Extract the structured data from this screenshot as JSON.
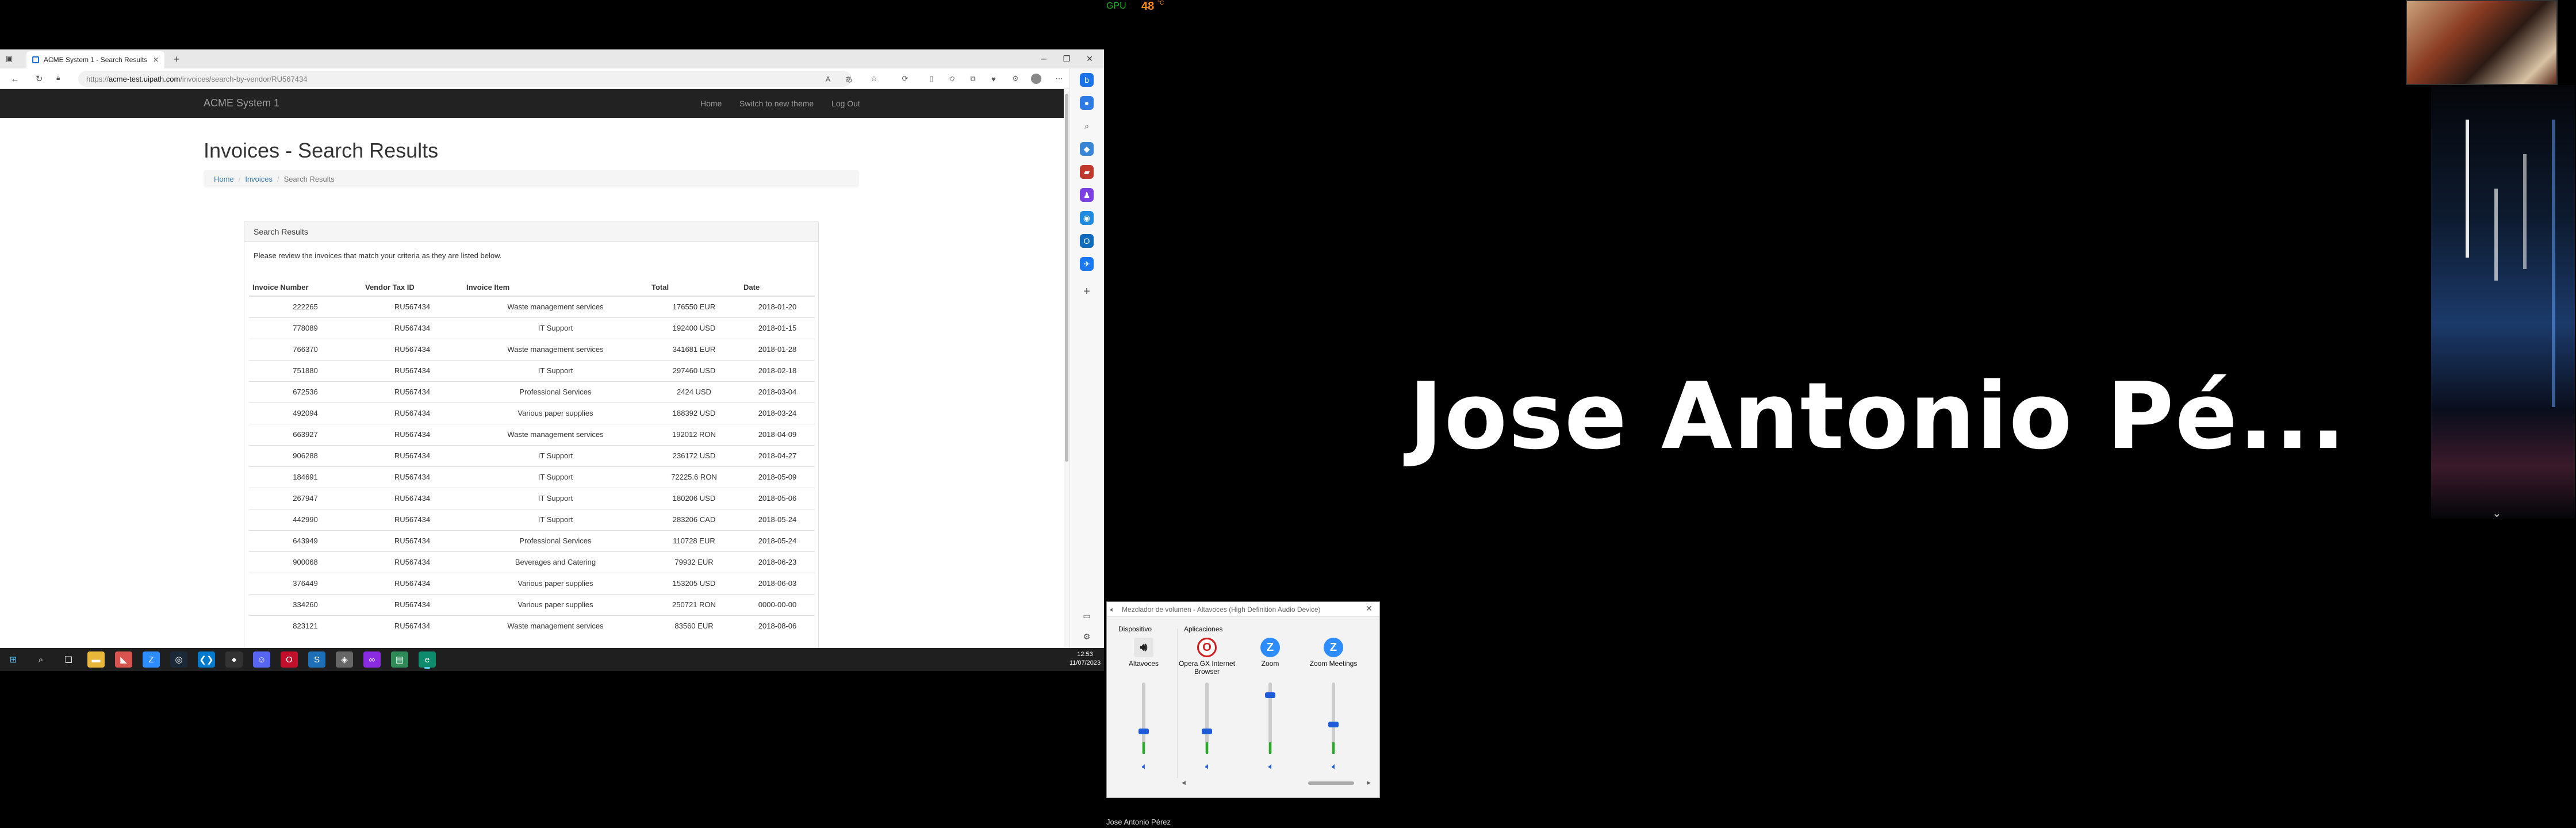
{
  "browser": {
    "tab_title": "ACME System 1 - Search Results",
    "url_prefix": "https://",
    "url_host": "acme-test.uipath.com",
    "url_path": "/invoices/search-by-vendor/RU567434"
  },
  "site": {
    "brand": "ACME System 1",
    "nav": [
      "Home",
      "Switch to new theme",
      "Log Out"
    ],
    "title": "Invoices - Search Results",
    "breadcrumb": [
      "Home",
      "Invoices",
      "Search Results"
    ],
    "panel_heading": "Search Results",
    "panel_intro": "Please review the invoices that match your criteria as they are listed below.",
    "columns": [
      "Invoice Number",
      "Vendor Tax ID",
      "Invoice Item",
      "Total",
      "Date"
    ],
    "rows": [
      [
        "222265",
        "RU567434",
        "Waste management services",
        "176550 EUR",
        "2018-01-20"
      ],
      [
        "778089",
        "RU567434",
        "IT Support",
        "192400 USD",
        "2018-01-15"
      ],
      [
        "766370",
        "RU567434",
        "Waste management services",
        "341681 EUR",
        "2018-01-28"
      ],
      [
        "751880",
        "RU567434",
        "IT Support",
        "297460 USD",
        "2018-02-18"
      ],
      [
        "672536",
        "RU567434",
        "Professional Services",
        "2424 USD",
        "2018-03-04"
      ],
      [
        "492094",
        "RU567434",
        "Various paper supplies",
        "188392 USD",
        "2018-03-24"
      ],
      [
        "663927",
        "RU567434",
        "Waste management services",
        "192012 RON",
        "2018-04-09"
      ],
      [
        "906288",
        "RU567434",
        "IT Support",
        "236172 USD",
        "2018-04-27"
      ],
      [
        "184691",
        "RU567434",
        "IT Support",
        "72225.6 RON",
        "2018-05-09"
      ],
      [
        "267947",
        "RU567434",
        "IT Support",
        "180206 USD",
        "2018-05-06"
      ],
      [
        "442990",
        "RU567434",
        "IT Support",
        "283206 CAD",
        "2018-05-24"
      ],
      [
        "643949",
        "RU567434",
        "Professional Services",
        "110728 EUR",
        "2018-05-24"
      ],
      [
        "900068",
        "RU567434",
        "Beverages and Catering",
        "79932 EUR",
        "2018-06-23"
      ],
      [
        "376449",
        "RU567434",
        "Various paper supplies",
        "153205 USD",
        "2018-06-03"
      ],
      [
        "334260",
        "RU567434",
        "Various paper supplies",
        "250721 RON",
        "0000-00-00"
      ],
      [
        "823121",
        "RU567434",
        "Waste management services",
        "83560 EUR",
        "2018-08-06"
      ]
    ]
  },
  "taskbar": {
    "time": "12:53",
    "date": "11/07/2023"
  },
  "overlay": {
    "gpu_label": "GPU",
    "gpu_value": "48",
    "gpu_unit": "°C",
    "speaker_name": "Jose Antonio Pé...",
    "caption": "Jose Antonio Pérez"
  },
  "mixer": {
    "title": "Mezclador de volumen - Altavoces (High Definition Audio Device)",
    "device_section": "Dispositivo",
    "apps_section": "Aplicaciones",
    "channels": [
      {
        "label": "Altavoces",
        "icon": "speaker-device-icon",
        "level": 0.3
      },
      {
        "label": "Opera GX Internet Browser",
        "icon": "opera-icon",
        "level": 0.3
      },
      {
        "label": "Zoom",
        "icon": "zoom-icon",
        "level": 0.85
      },
      {
        "label": "Zoom Meetings",
        "icon": "zoom-icon",
        "level": 0.4
      }
    ]
  },
  "colors": {
    "navbar": "#222222",
    "link": "#337ab7",
    "gpu_label": "#1db31d",
    "gpu_value": "#ff8c1a",
    "zoom_blue": "#2d8cff"
  }
}
